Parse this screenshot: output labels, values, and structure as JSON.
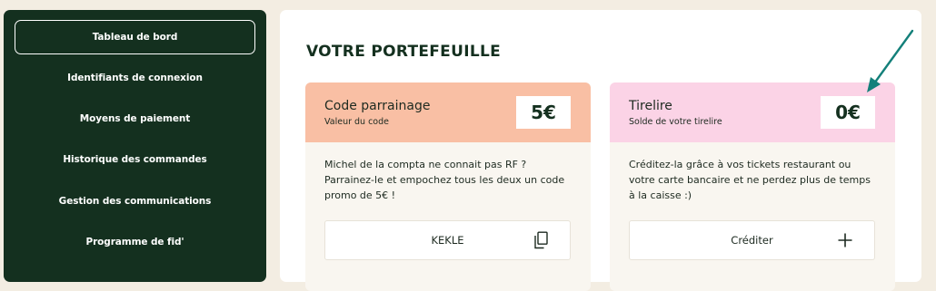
{
  "sidebar": {
    "items": [
      {
        "label": "Tableau de bord",
        "active": true
      },
      {
        "label": "Identifiants de connexion"
      },
      {
        "label": "Moyens de paiement"
      },
      {
        "label": "Historique des commandes"
      },
      {
        "label": "Gestion des communications"
      },
      {
        "label": "Programme de fid'"
      }
    ]
  },
  "main": {
    "title": "VOTRE PORTEFEUILLE",
    "referral": {
      "title": "Code parrainage",
      "subtitle": "Valeur du code",
      "amount": "5€",
      "text": "Michel de la compta ne connait pas RF ? Parrainez-le et empochez tous les deux un code promo de 5€ !",
      "code": "KEKLE",
      "icon": "copy-icon"
    },
    "piggy": {
      "title": "Tirelire",
      "subtitle": "Solde de votre tirelire",
      "amount": "0€",
      "text": "Créditez-la grâce à vos tickets restaurant ou votre carte bancaire et ne perdez plus de temps à la caisse :)",
      "action": "Créditer",
      "icon": "plus-icon"
    }
  },
  "colors": {
    "sidebar": "#14301f",
    "referral_header": "#f9bfa4",
    "piggy_header": "#fbd3e6",
    "annotation_arrow": "#14807a"
  }
}
